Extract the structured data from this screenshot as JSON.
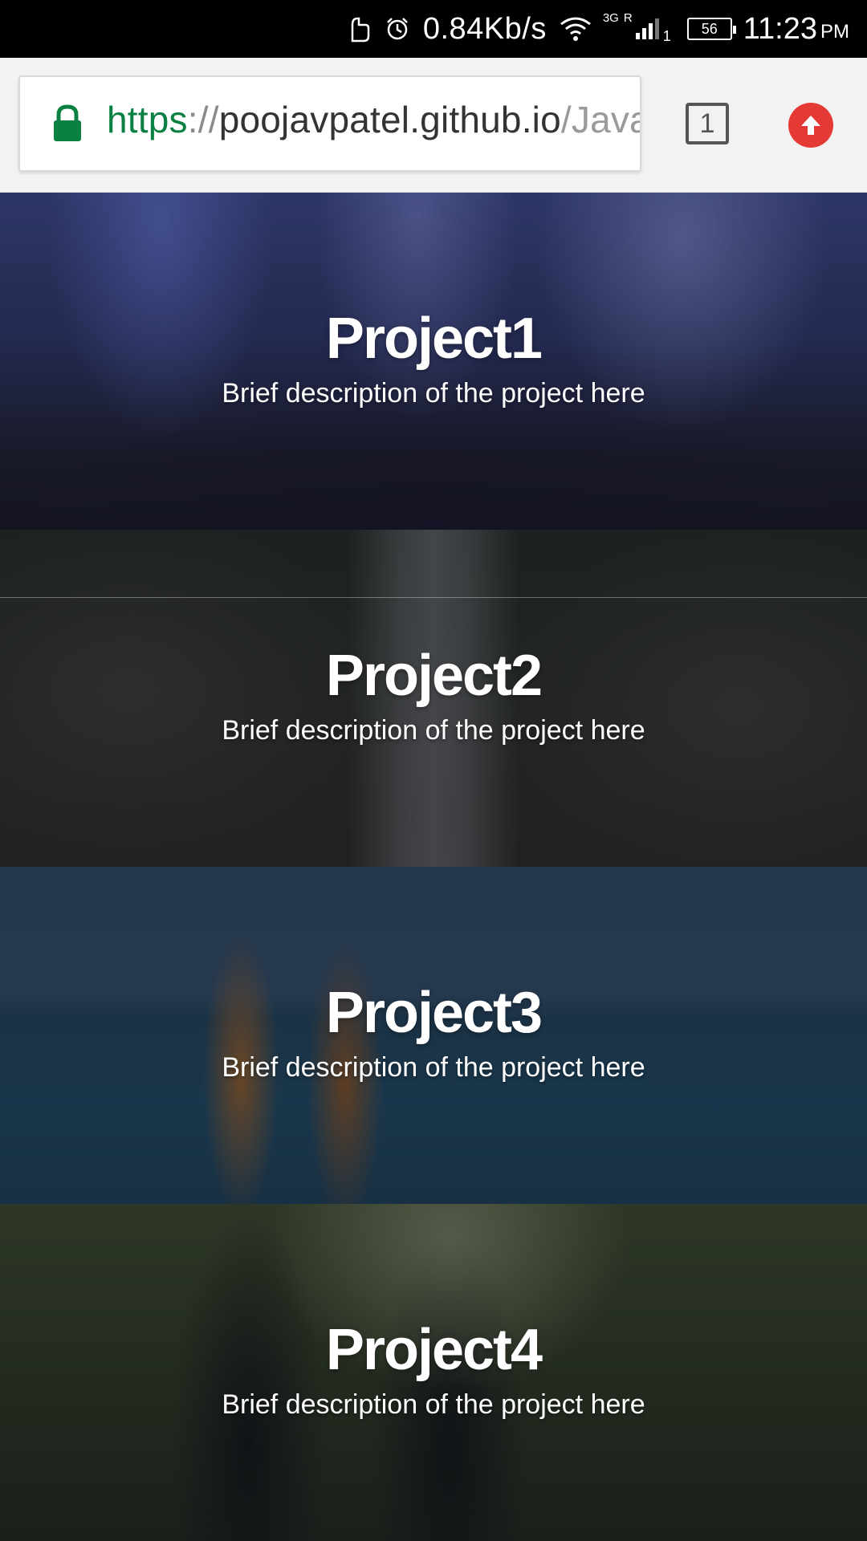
{
  "status_bar": {
    "speed": "0.84Kb/s",
    "network_type": "3G",
    "roaming": "R",
    "sim": "1",
    "battery": "56",
    "time": "11:23",
    "ampm": "PM"
  },
  "browser": {
    "url_scheme": "https",
    "url_sep": "://",
    "url_host": "poojavpatel.github.io",
    "url_path": "/Java",
    "tab_count": "1"
  },
  "projects": [
    {
      "title": "Project1",
      "description": "Brief description of the project here"
    },
    {
      "title": "Project2",
      "description": "Brief description of the project here"
    },
    {
      "title": "Project3",
      "description": "Brief description of the project here"
    },
    {
      "title": "Project4",
      "description": "Brief description of the project here"
    }
  ],
  "colors": {
    "secure": "#0b8043",
    "upload": "#e53935"
  }
}
